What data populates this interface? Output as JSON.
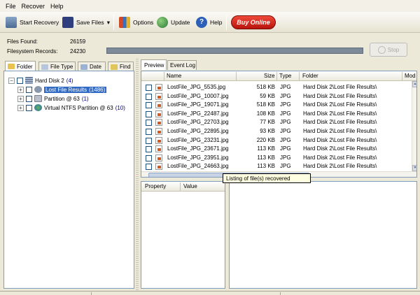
{
  "menu": {
    "file": "File",
    "recover": "Recover",
    "help": "Help"
  },
  "toolbar": {
    "start_recovery": "Start Recovery",
    "save_files": "Save Files",
    "save_files_arrow": "▾",
    "options": "Options",
    "update": "Update",
    "help": "Help",
    "buy_online": "Buy Online"
  },
  "stats": {
    "files_found_label": "Files Found:",
    "files_found_value": "26159",
    "filesystem_records_label": "Filesystem Records:",
    "filesystem_records_value": "24230"
  },
  "stop_label": "Stop",
  "left_tabs": [
    "Folder",
    "File Type",
    "Date",
    "Find"
  ],
  "right_tabs": [
    "Preview",
    "Event Log"
  ],
  "tree": {
    "root": {
      "label": "Hard Disk 2",
      "count": "(4)"
    },
    "children": [
      {
        "label": "Lost File Results",
        "count": "(1486)",
        "selected": true
      },
      {
        "label": "Partition @ 63",
        "count": "(1)"
      },
      {
        "label": "Virtual NTFS Partition @ 63",
        "count": "(10)"
      }
    ]
  },
  "file_columns": [
    "Name",
    "Size",
    "Type",
    "Folder",
    "Mod"
  ],
  "files": [
    {
      "name": "LostFile_JPG_5535.jpg",
      "size": "518 KB",
      "type": "JPG",
      "folder": "Hard Disk 2\\Lost File Results\\"
    },
    {
      "name": "LostFile_JPG_10007.jpg",
      "size": "59 KB",
      "type": "JPG",
      "folder": "Hard Disk 2\\Lost File Results\\"
    },
    {
      "name": "LostFile_JPG_19071.jpg",
      "size": "518 KB",
      "type": "JPG",
      "folder": "Hard Disk 2\\Lost File Results\\"
    },
    {
      "name": "LostFile_JPG_22487.jpg",
      "size": "108 KB",
      "type": "JPG",
      "folder": "Hard Disk 2\\Lost File Results\\"
    },
    {
      "name": "LostFile_JPG_22703.jpg",
      "size": "77 KB",
      "type": "JPG",
      "folder": "Hard Disk 2\\Lost File Results\\"
    },
    {
      "name": "LostFile_JPG_22895.jpg",
      "size": "93 KB",
      "type": "JPG",
      "folder": "Hard Disk 2\\Lost File Results\\"
    },
    {
      "name": "LostFile_JPG_23231.jpg",
      "size": "220 KB",
      "type": "JPG",
      "folder": "Hard Disk 2\\Lost File Results\\"
    },
    {
      "name": "LostFile_JPG_23671.jpg",
      "size": "113 KB",
      "type": "JPG",
      "folder": "Hard Disk 2\\Lost File Results\\"
    },
    {
      "name": "LostFile_JPG_23951.jpg",
      "size": "113 KB",
      "type": "JPG",
      "folder": "Hard Disk 2\\Lost File Results\\"
    },
    {
      "name": "LostFile_JPG_24663.jpg",
      "size": "113 KB",
      "type": "JPG",
      "folder": "Hard Disk 2\\Lost File Results\\"
    }
  ],
  "tooltip": "Listing of file(s) recovered",
  "property_columns": [
    "Property",
    "Value"
  ],
  "colors": {
    "buy_online": "#c4170f",
    "selection": "#316ac5",
    "progress": "#7d8a98"
  }
}
